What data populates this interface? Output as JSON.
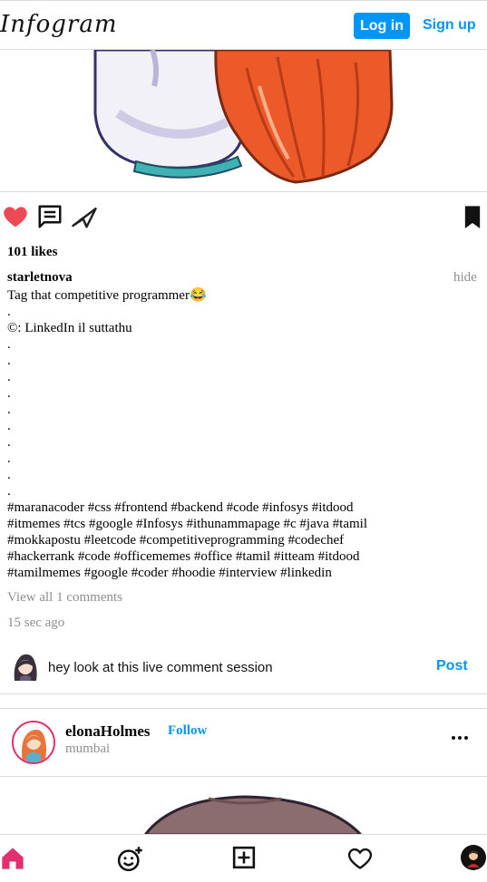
{
  "header": {
    "logo": "Infogram",
    "login_label": "Log in",
    "signup_label": "Sign up"
  },
  "post": {
    "likes": "101 likes",
    "author": "starletnova",
    "hide_label": "hide",
    "caption_lines": [
      "Tag that competitive programmer😂",
      ".",
      "©: LinkedIn il suttathu",
      ".",
      ".",
      ".",
      ".",
      ".",
      ".",
      ".",
      ".",
      ".",
      ".",
      "#maranacoder #css #frontend #backend #code #infosys #itdood",
      "#itmemes #tcs #google #Infosys #ithunammapage #c #java #tamil",
      "#mokkapostu #leetcode #competitiveprogramming #codechef",
      "#hackerrank #code #officememes #office #tamil #itteam #itdood",
      "#tamilmemes #google #coder #hoodie #interview #linkedin"
    ],
    "view_comments": "View all 1 comments",
    "time": "15 sec ago",
    "comment_value": "hey look at this live comment session",
    "post_label": "Post"
  },
  "post2": {
    "username": "elonaHolmes",
    "follow_label": "Follow",
    "location": "mumbai"
  },
  "icons": {
    "like": "heart-filled-icon",
    "comment": "comment-icon",
    "share": "paper-plane-icon",
    "save": "bookmark-icon",
    "more": "more-horizontal-icon",
    "nav_home": "home-icon",
    "nav_explore": "emoji-add-icon",
    "nav_add": "add-square-icon",
    "nav_activity": "heart-outline-icon",
    "nav_profile": "profile-avatar-icon"
  },
  "colors": {
    "accent": "#0095f6",
    "like": "#ed4956",
    "home": "#e1306c"
  }
}
